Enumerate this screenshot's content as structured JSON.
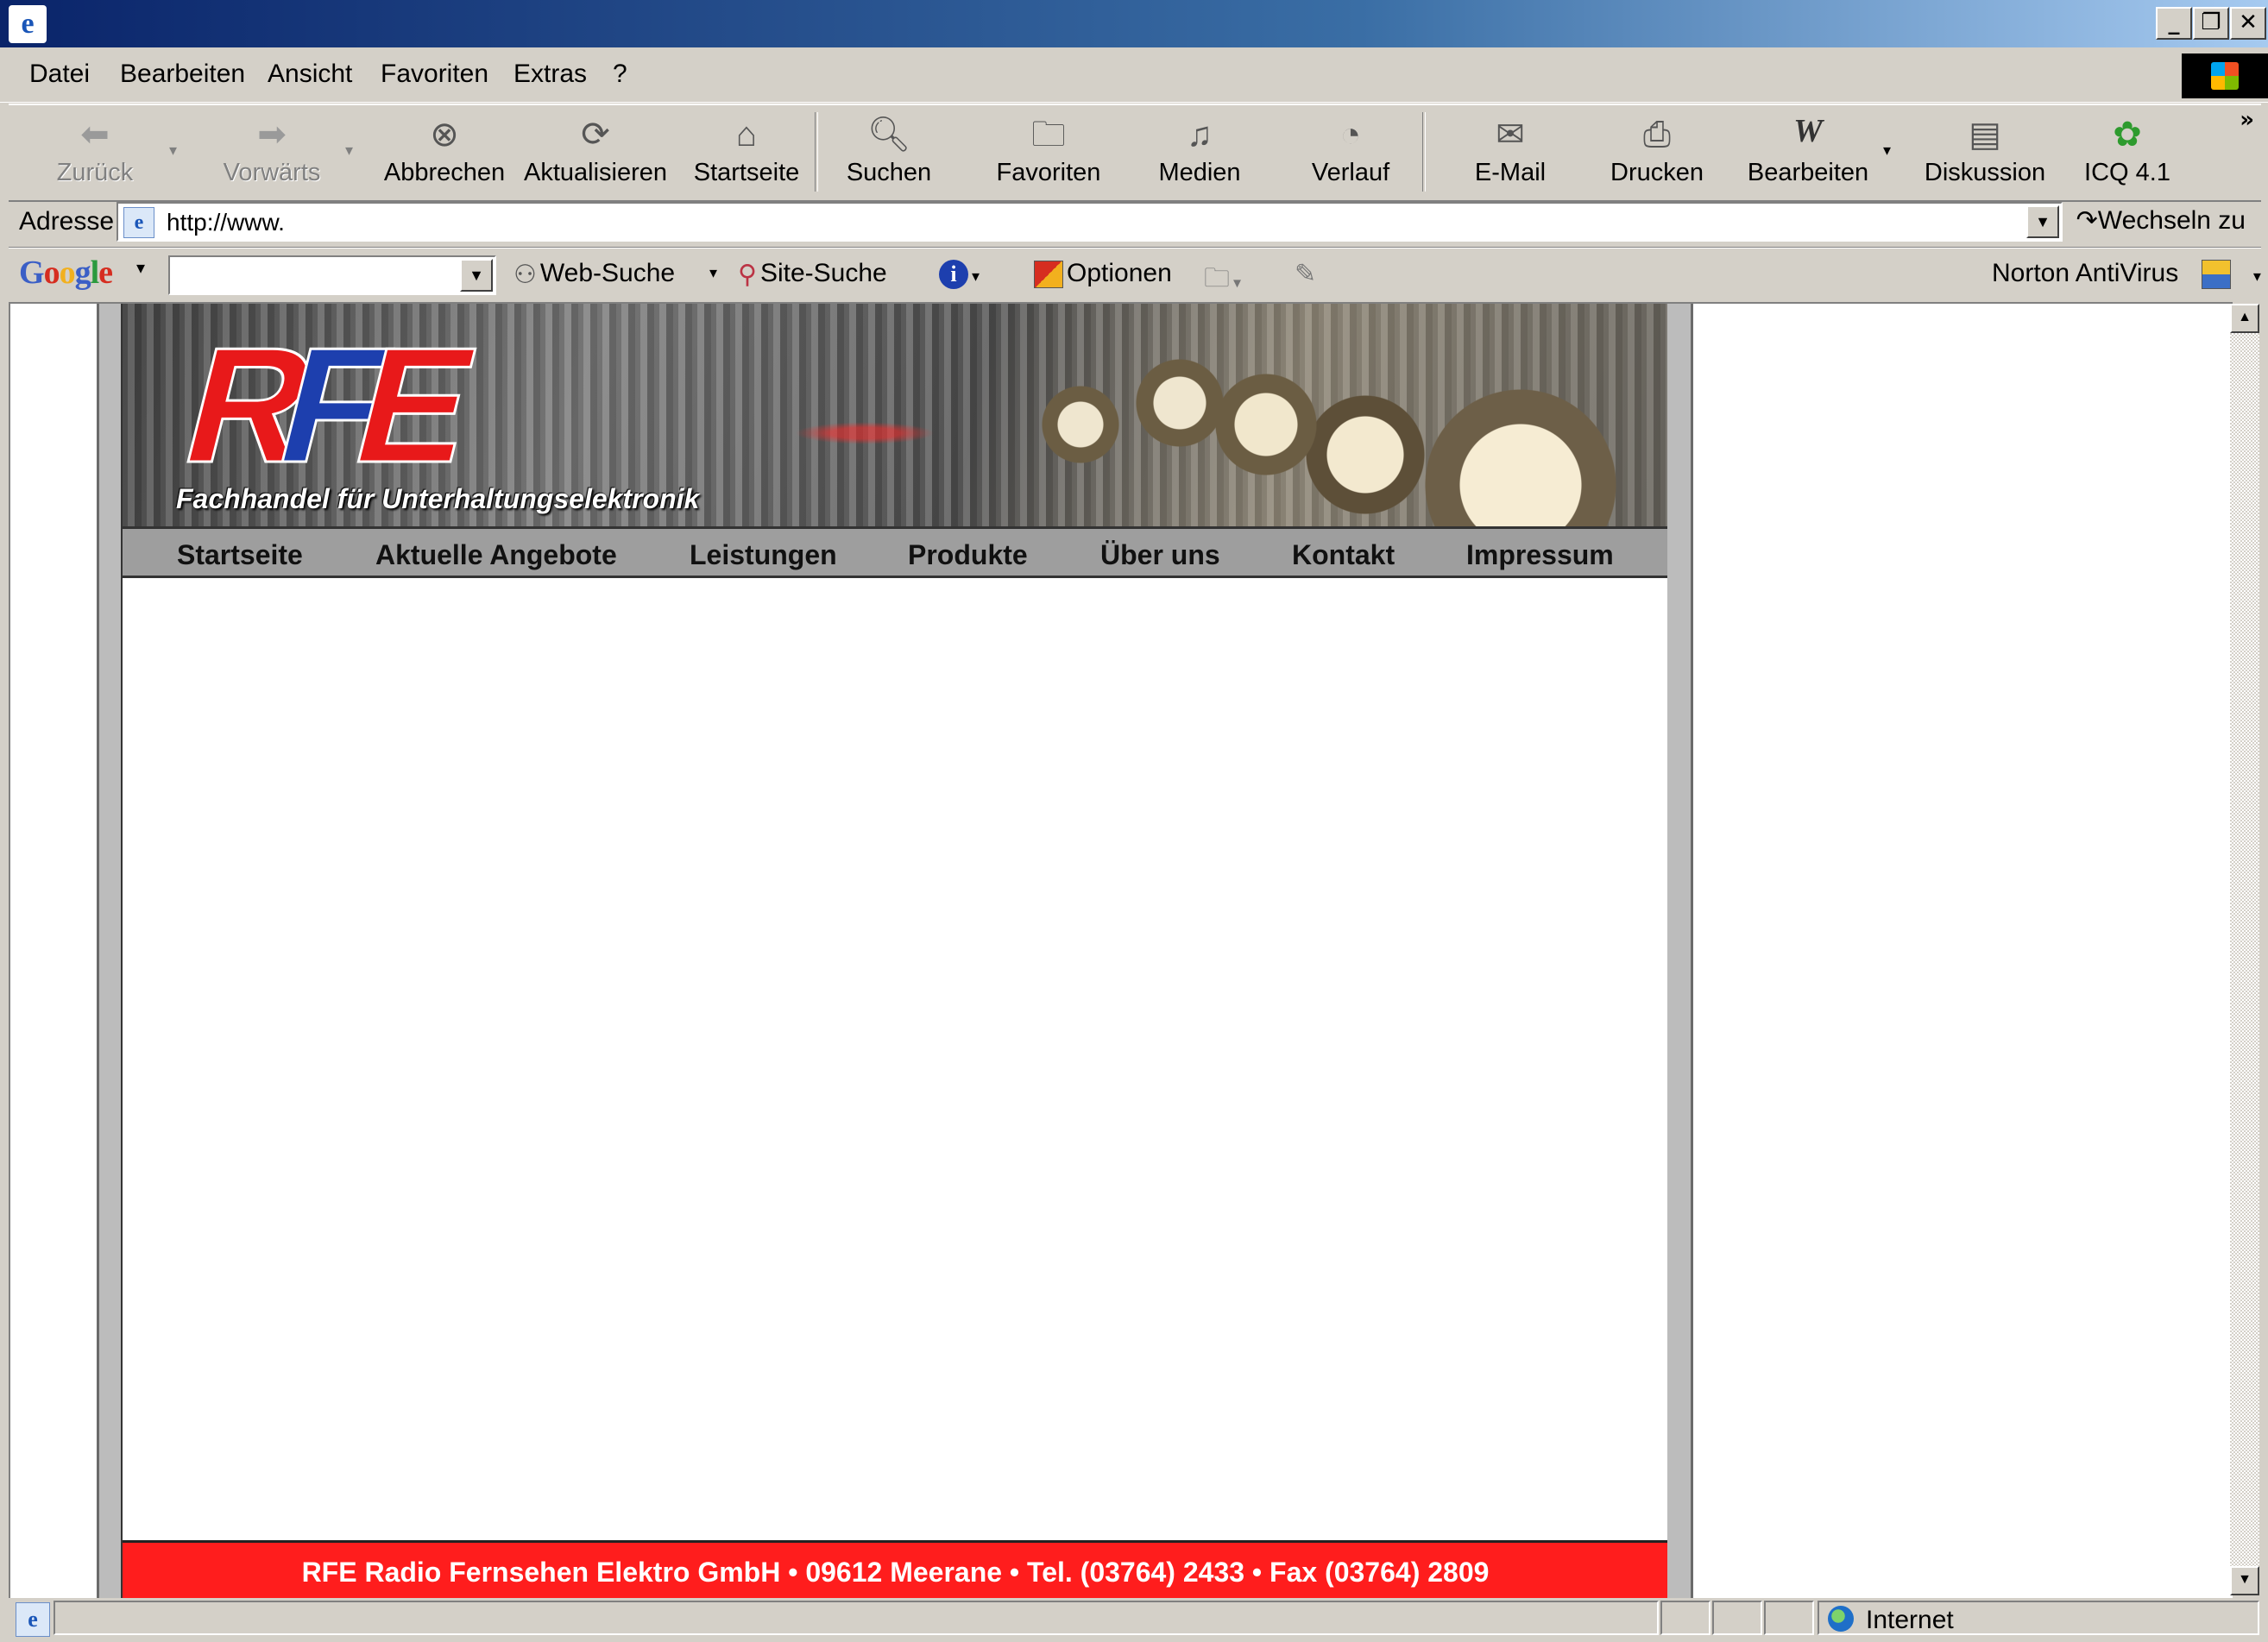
{
  "browser": {
    "window_buttons": {
      "minimize": "_",
      "restore": "❐",
      "close": "✕"
    },
    "menu": [
      "Datei",
      "Bearbeiten",
      "Ansicht",
      "Favoriten",
      "Extras",
      "?"
    ],
    "toolbar": {
      "back": "Zurück",
      "forward": "Vorwärts",
      "stop": "Abbrechen",
      "refresh": "Aktualisieren",
      "home": "Startseite",
      "search": "Suchen",
      "favorites": "Favoriten",
      "media": "Medien",
      "history": "Verlauf",
      "mail": "E-Mail",
      "print": "Drucken",
      "edit": "Bearbeiten",
      "discuss": "Diskussion",
      "icq": "ICQ 4.1"
    },
    "address": {
      "label": "Adresse",
      "value": "http://www.",
      "go": "Wechseln zu"
    },
    "google_toolbar": {
      "logo": "Google",
      "web_search": "Web-Suche",
      "site_search": "Site-Suche",
      "options": "Optionen",
      "norton": "Norton AntiVirus"
    },
    "status": {
      "zone": "Internet"
    }
  },
  "site": {
    "logo": "RFE",
    "slogan": "Fachhandel für Unterhaltungselektronik",
    "nav": [
      "Startseite",
      "Aktuelle Angebote",
      "Leistungen",
      "Produkte",
      "Über uns",
      "Kontakt",
      "Impressum"
    ],
    "footer": "RFE Radio Fernsehen Elektro GmbH • 09612 Meerane • Tel. (03764) 2433 • Fax (03764) 2809",
    "colors": {
      "logo_red": "#e8191a",
      "logo_blue": "#1d3fae",
      "footer_red": "#ff1d1d",
      "nav_gray": "#9e9e9e"
    }
  }
}
